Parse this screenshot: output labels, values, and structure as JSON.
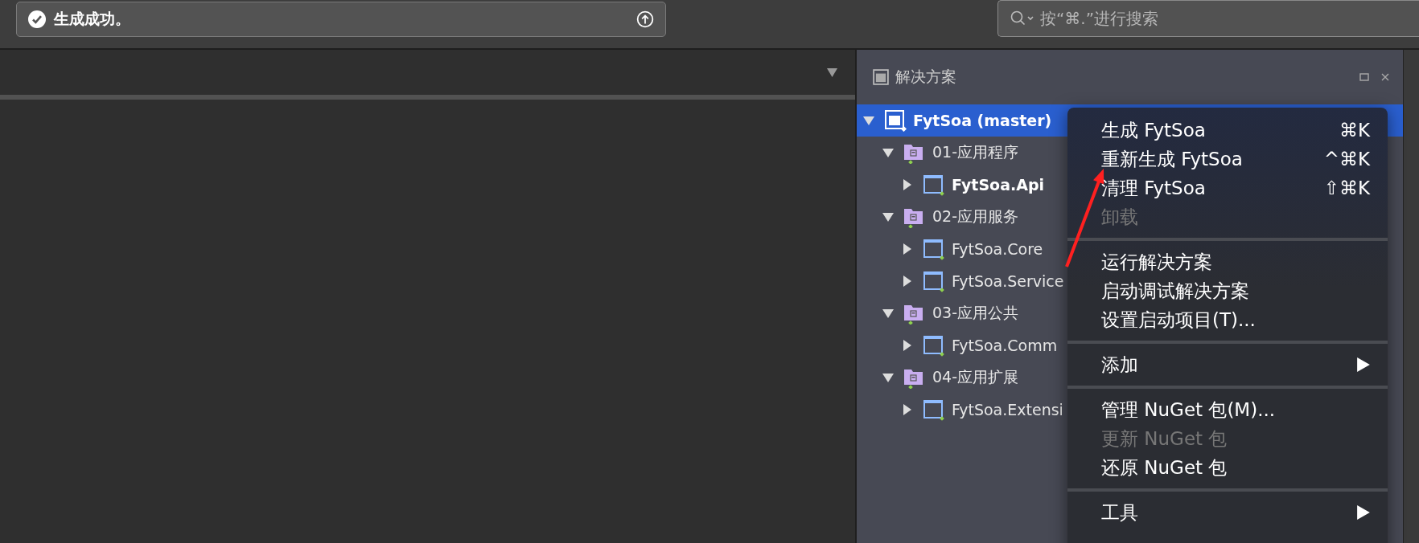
{
  "status_bar": {
    "message": "生成成功。"
  },
  "search": {
    "placeholder": "按“⌘.”进行搜索"
  },
  "solution_panel": {
    "title": "解决方案",
    "tree": [
      {
        "kind": "solution",
        "label": "FytSoa (master)",
        "expanded": true,
        "selected": true,
        "children": [
          {
            "kind": "folder",
            "label": "01-应用程序",
            "expanded": true,
            "selected": false,
            "startup": false,
            "children": [
              {
                "kind": "project",
                "label": "FytSoa.Api",
                "expanded": false,
                "selected": false,
                "startup": true
              }
            ]
          },
          {
            "kind": "folder",
            "label": "02-应用服务",
            "expanded": true,
            "selected": false,
            "startup": false,
            "children": [
              {
                "kind": "project",
                "label": "FytSoa.Core",
                "expanded": false,
                "selected": false,
                "startup": false
              },
              {
                "kind": "project",
                "label": "FytSoa.Service",
                "expanded": false,
                "selected": false,
                "startup": false
              }
            ]
          },
          {
            "kind": "folder",
            "label": "03-应用公共",
            "expanded": true,
            "selected": false,
            "startup": false,
            "children": [
              {
                "kind": "project",
                "label": "FytSoa.Comm",
                "expanded": false,
                "selected": false,
                "startup": false
              }
            ]
          },
          {
            "kind": "folder",
            "label": "04-应用扩展",
            "expanded": true,
            "selected": false,
            "startup": false,
            "children": [
              {
                "kind": "project",
                "label": "FytSoa.Extensi",
                "expanded": false,
                "selected": false,
                "startup": false
              }
            ]
          }
        ]
      }
    ]
  },
  "context_menu": {
    "items": [
      {
        "kind": "item",
        "label": "生成 FytSoa",
        "shortcut": "⌘K",
        "disabled": false,
        "submenu": false
      },
      {
        "kind": "item",
        "label": "重新生成 FytSoa",
        "shortcut": "^⌘K",
        "disabled": false,
        "submenu": false
      },
      {
        "kind": "item",
        "label": "清理 FytSoa",
        "shortcut": "⇧⌘K",
        "disabled": false,
        "submenu": false
      },
      {
        "kind": "item",
        "label": "卸载",
        "disabled": true,
        "submenu": false
      },
      {
        "kind": "separator"
      },
      {
        "kind": "item",
        "label": "运行解决方案",
        "disabled": false,
        "submenu": false
      },
      {
        "kind": "item",
        "label": "启动调试解决方案",
        "disabled": false,
        "submenu": false
      },
      {
        "kind": "item",
        "label": "设置启动项目(T)...",
        "disabled": false,
        "submenu": false
      },
      {
        "kind": "separator"
      },
      {
        "kind": "item",
        "label": "添加",
        "disabled": false,
        "submenu": true
      },
      {
        "kind": "separator"
      },
      {
        "kind": "item",
        "label": "管理 NuGet 包(M)...",
        "disabled": false,
        "submenu": false
      },
      {
        "kind": "item",
        "label": "更新 NuGet 包",
        "disabled": true,
        "submenu": false
      },
      {
        "kind": "item",
        "label": "还原 NuGet 包",
        "disabled": false,
        "submenu": false
      },
      {
        "kind": "separator"
      },
      {
        "kind": "item",
        "label": "工具",
        "disabled": false,
        "submenu": true
      }
    ]
  }
}
